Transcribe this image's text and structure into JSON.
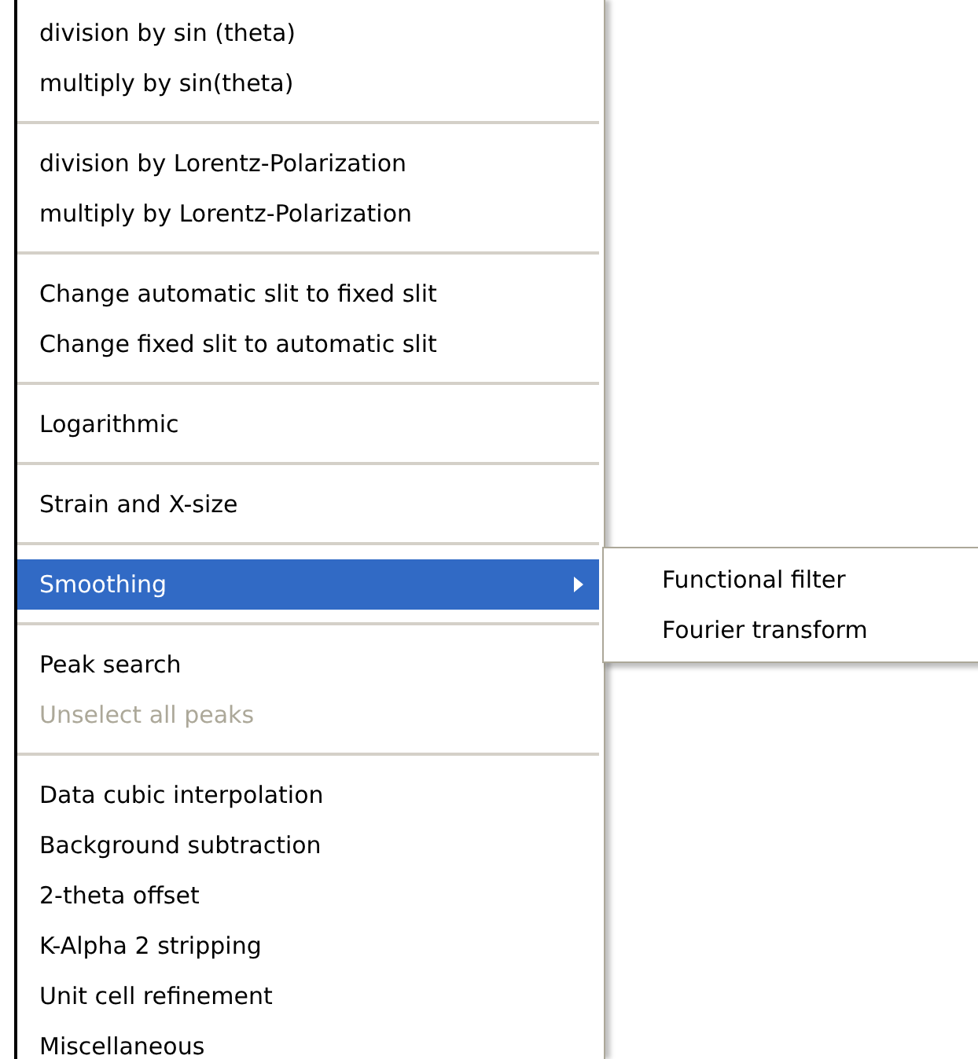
{
  "menu": {
    "groups": [
      [
        {
          "label": "division by sin (theta)",
          "selected": false,
          "disabled": false
        },
        {
          "label": "multiply by sin(theta)",
          "selected": false,
          "disabled": false
        }
      ],
      [
        {
          "label": "division by Lorentz-Polarization",
          "selected": false,
          "disabled": false
        },
        {
          "label": "multiply by Lorentz-Polarization",
          "selected": false,
          "disabled": false
        }
      ],
      [
        {
          "label": "Change automatic slit to fixed slit",
          "selected": false,
          "disabled": false
        },
        {
          "label": "Change fixed slit to automatic slit",
          "selected": false,
          "disabled": false
        }
      ],
      [
        {
          "label": "Logarithmic",
          "selected": false,
          "disabled": false
        }
      ],
      [
        {
          "label": "Strain and X-size",
          "selected": false,
          "disabled": false
        }
      ],
      [
        {
          "label": "Smoothing",
          "selected": true,
          "disabled": false,
          "submenu": [
            {
              "label": "Functional filter",
              "selected": false,
              "disabled": false
            },
            {
              "label": "Fourier transform",
              "selected": false,
              "disabled": false
            }
          ]
        }
      ],
      [
        {
          "label": "Peak search",
          "selected": false,
          "disabled": false
        },
        {
          "label": "Unselect all peaks",
          "selected": false,
          "disabled": true
        }
      ],
      [
        {
          "label": "Data cubic interpolation",
          "selected": false,
          "disabled": false
        },
        {
          "label": "Background subtraction",
          "selected": false,
          "disabled": false
        },
        {
          "label": "2-theta offset",
          "selected": false,
          "disabled": false
        },
        {
          "label": "K-Alpha 2 stripping",
          "selected": false,
          "disabled": false
        },
        {
          "label": "Unit cell refinement",
          "selected": false,
          "disabled": false
        },
        {
          "label": "Miscellaneous",
          "selected": false,
          "disabled": false
        }
      ]
    ]
  }
}
